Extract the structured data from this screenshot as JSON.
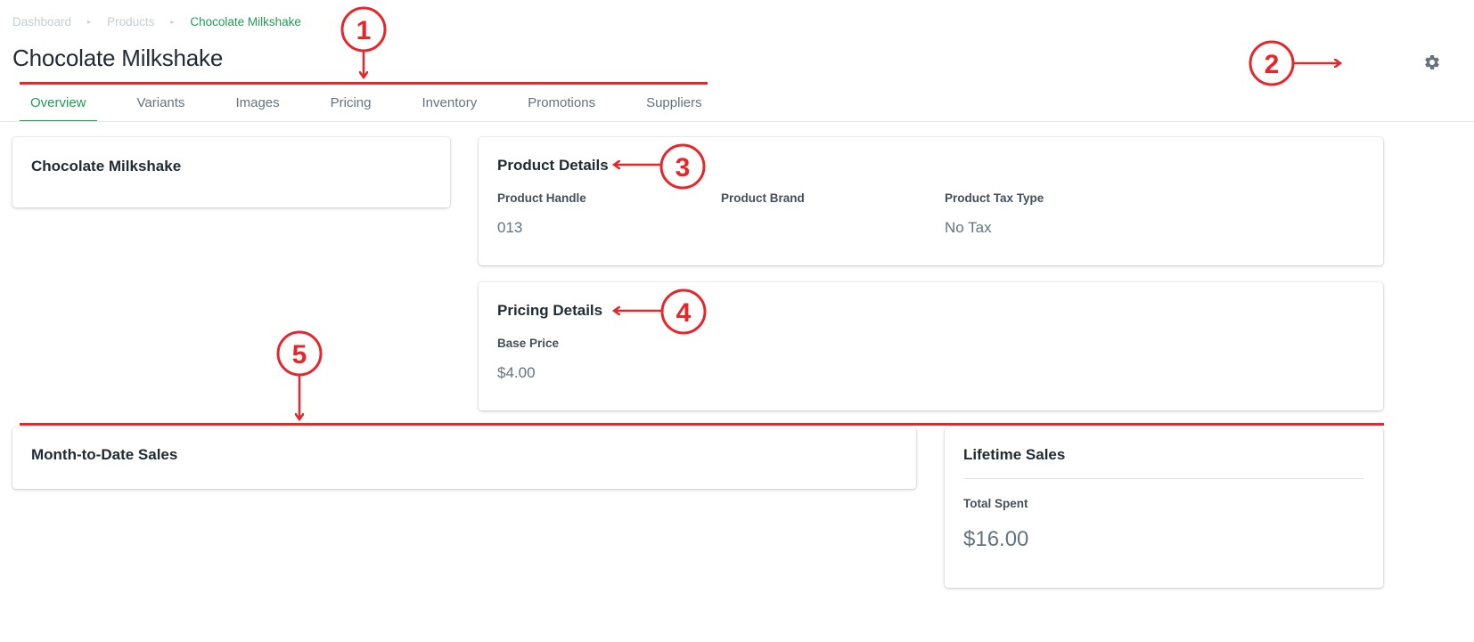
{
  "breadcrumb": {
    "items": [
      "Dashboard",
      "Products",
      "Chocolate Milkshake"
    ]
  },
  "page": {
    "title": "Chocolate Milkshake"
  },
  "tabs": [
    {
      "label": "Overview",
      "active": true
    },
    {
      "label": "Variants",
      "active": false
    },
    {
      "label": "Images",
      "active": false
    },
    {
      "label": "Pricing",
      "active": false
    },
    {
      "label": "Inventory",
      "active": false
    },
    {
      "label": "Promotions",
      "active": false
    },
    {
      "label": "Suppliers",
      "active": false
    }
  ],
  "settings": {
    "icon": "gear-icon"
  },
  "summary_card": {
    "title": "Chocolate Milkshake"
  },
  "product_details": {
    "title": "Product Details",
    "fields": [
      {
        "label": "Product Handle",
        "value": "013"
      },
      {
        "label": "Product Brand",
        "value": ""
      },
      {
        "label": "Product Tax Type",
        "value": "No Tax"
      }
    ]
  },
  "pricing_details": {
    "title": "Pricing Details",
    "fields": [
      {
        "label": "Base Price",
        "value": "$4.00"
      }
    ]
  },
  "mtd_sales": {
    "title": "Month-to-Date Sales"
  },
  "lifetime_sales": {
    "title": "Lifetime Sales",
    "label": "Total Spent",
    "value": "$16.00"
  },
  "annotations": {
    "markers": [
      "1",
      "2",
      "3",
      "4",
      "5"
    ],
    "color": "#e8262a"
  },
  "colors": {
    "accent": "#1f9d55",
    "text": "#212b36",
    "muted": "#637381"
  }
}
